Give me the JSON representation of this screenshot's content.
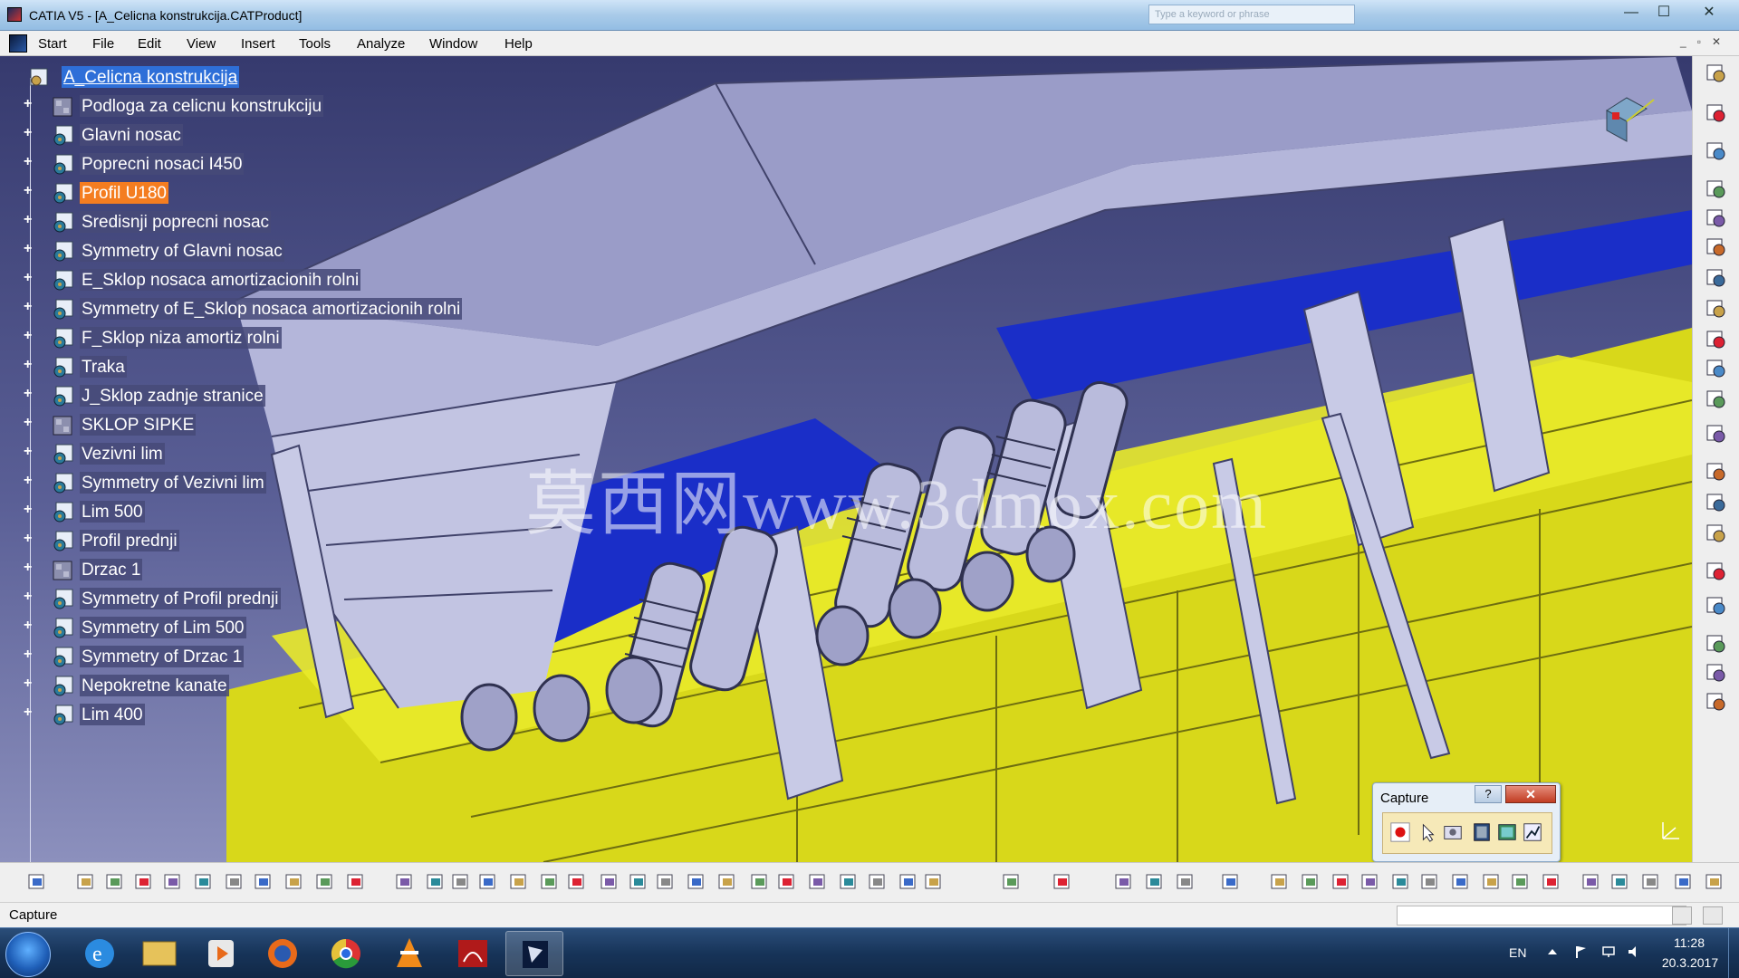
{
  "window": {
    "title": "CATIA V5 - [A_Celicna konstrukcija.CATProduct]",
    "search_placeholder": "Type a keyword or phrase",
    "minimize": "—",
    "maximize": "☐",
    "close": "✕"
  },
  "menu": {
    "items": [
      "Start",
      "File",
      "Edit",
      "View",
      "Insert",
      "Tools",
      "Analyze",
      "Window",
      "Help"
    ]
  },
  "tree": {
    "root": "A_Celicna konstrukcija",
    "items": [
      {
        "label": "Podloga za celicnu konstrukciju",
        "icon": "part-icon"
      },
      {
        "label": "Glavni nosac",
        "icon": "product-icon"
      },
      {
        "label": "Poprecni nosaci I450",
        "icon": "product-icon"
      },
      {
        "label": "Profil U180",
        "icon": "product-icon",
        "selected": true
      },
      {
        "label": "Sredisnji poprecni nosac",
        "icon": "product-icon"
      },
      {
        "label": "Symmetry of Glavni nosac",
        "icon": "product-icon"
      },
      {
        "label": "E_Sklop nosaca amortizacionih rolni",
        "icon": "product-icon"
      },
      {
        "label": "Symmetry of E_Sklop nosaca amortizacionih rolni",
        "icon": "product-icon"
      },
      {
        "label": "F_Sklop niza amortiz rolni",
        "icon": "product-icon"
      },
      {
        "label": "Traka",
        "icon": "product-icon"
      },
      {
        "label": "J_Sklop zadnje stranice",
        "icon": "product-icon"
      },
      {
        "label": "SKLOP SIPKE",
        "icon": "part-icon"
      },
      {
        "label": "Vezivni lim",
        "icon": "product-icon"
      },
      {
        "label": "Symmetry of Vezivni lim",
        "icon": "product-icon"
      },
      {
        "label": "Lim 500",
        "icon": "product-icon"
      },
      {
        "label": "Profil prednji",
        "icon": "product-icon"
      },
      {
        "label": "Drzac 1",
        "icon": "part-icon"
      },
      {
        "label": "Symmetry of Profil prednji",
        "icon": "product-icon"
      },
      {
        "label": "Symmetry of Lim 500",
        "icon": "product-icon"
      },
      {
        "label": "Symmetry of Drzac 1",
        "icon": "product-icon"
      },
      {
        "label": "Nepokretne kanate",
        "icon": "product-icon"
      },
      {
        "label": "Lim 400",
        "icon": "product-icon"
      }
    ],
    "expand_symbol": "+"
  },
  "watermark": "莫西网www.3dmox.com",
  "capture_dialog": {
    "title": "Capture",
    "help": "?",
    "close": "✕",
    "tools": [
      "record-icon",
      "select-icon",
      "capture-options-icon",
      "album-icon",
      "image-icon",
      "settings-icon"
    ]
  },
  "status": {
    "text": "Capture"
  },
  "taskbar": {
    "language": "EN",
    "time": "11:28",
    "date": "20.3.2017",
    "apps": [
      "internet-explorer-icon",
      "file-explorer-icon",
      "media-player-icon",
      "firefox-icon",
      "chrome-icon",
      "vlc-icon",
      "acrobat-icon",
      "catia-icon"
    ]
  },
  "colors": {
    "selection_orange": "#f47d20",
    "root_highlight": "#2e6fd8",
    "model_grey": "#a9abd0",
    "model_yellow": "#e3e41e",
    "model_blue": "#1a2ec8"
  }
}
